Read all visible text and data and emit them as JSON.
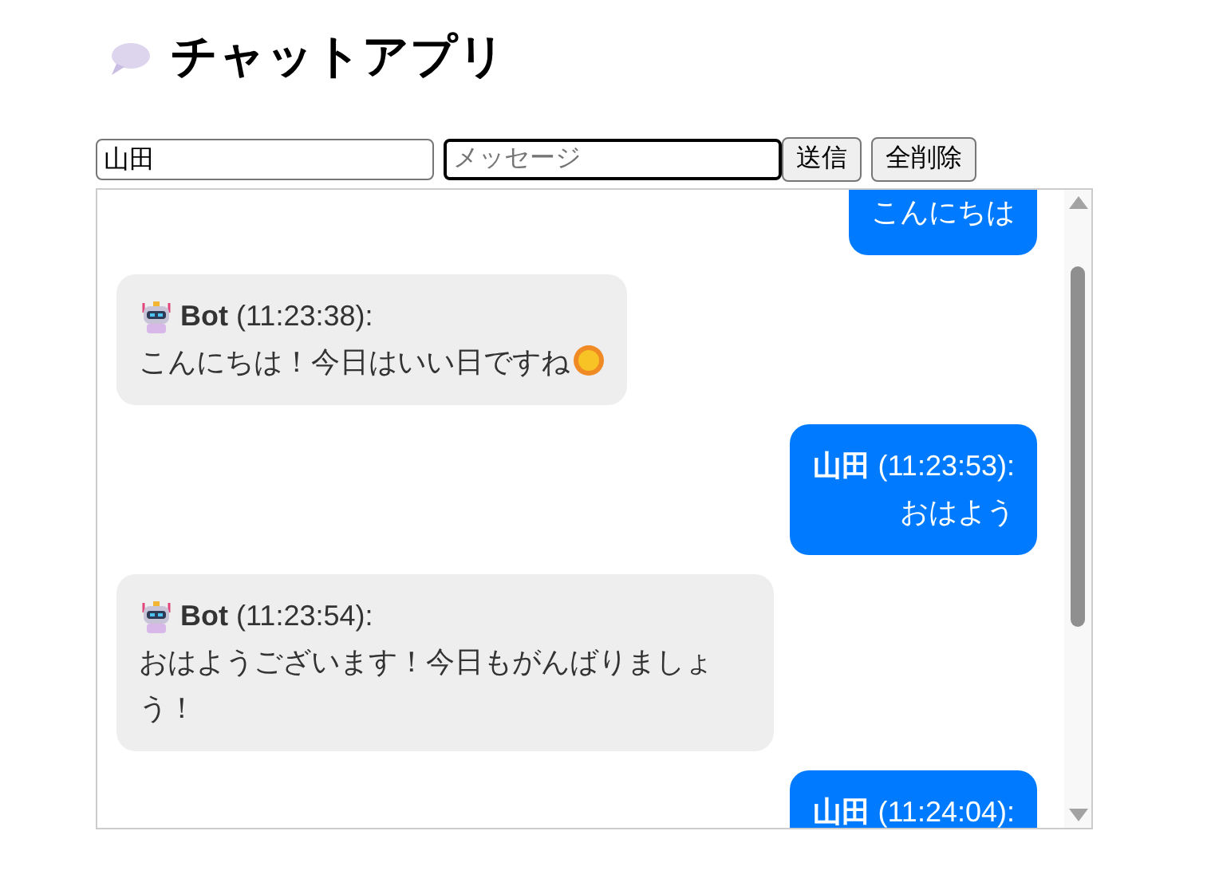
{
  "title": "チャットアプリ",
  "form": {
    "name_value": "山田",
    "message_placeholder": "メッセージ",
    "buttons": [
      "送信",
      "全削除"
    ]
  },
  "messages": [
    {
      "kind": "user",
      "text": "こんにちは"
    },
    {
      "kind": "bot",
      "sender": "Bot",
      "time": "(11:23:38):",
      "text": "こんにちは！今日はいい日ですね",
      "sun_icon": true
    },
    {
      "kind": "user",
      "sender": "山田",
      "time": "(11:23:53):",
      "text": "おはよう"
    },
    {
      "kind": "bot",
      "sender": "Bot",
      "time": "(11:23:54):",
      "text": "おはようございます！今日もがんばりましょう！"
    },
    {
      "kind": "user",
      "sender": "山田",
      "time": "(11:24:04):"
    }
  ]
}
